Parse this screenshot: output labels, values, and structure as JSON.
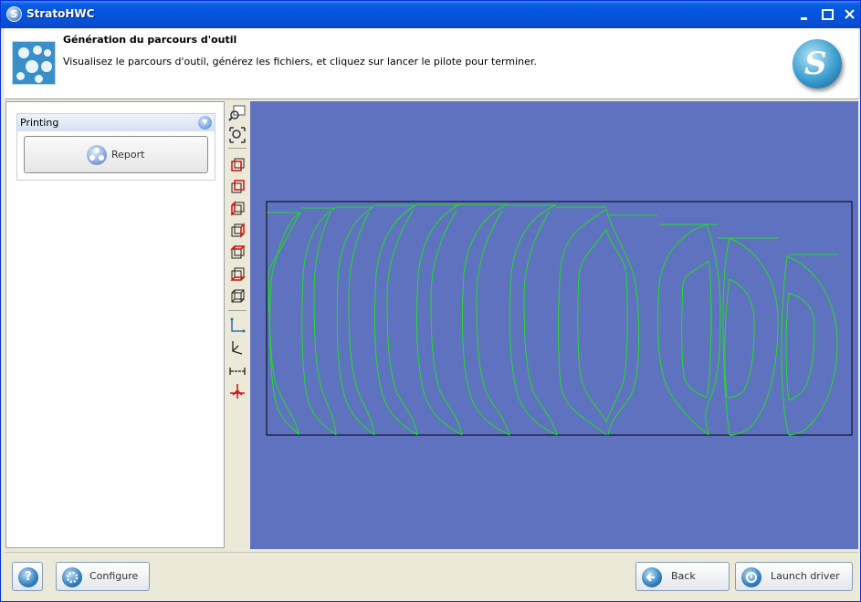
{
  "window": {
    "title": "StratoHWC",
    "app_icon_letter": "S"
  },
  "header": {
    "title": "Génération du parcours d'outil",
    "description": "Visualisez le parcours d'outil, générez les fichiers, et cliquez sur lancer le pilote pour terminer.",
    "logo_letter": "S"
  },
  "left_panel": {
    "section_label": "Printing",
    "report_label": "Report"
  },
  "toolbar": {
    "tools": [
      "zoom-in-icon",
      "zoom-fit-icon",
      "view-front-icon",
      "view-back-icon",
      "view-left-icon",
      "view-right-icon",
      "view-top-icon",
      "view-bottom-icon",
      "view-iso-icon",
      "axes-xy-icon",
      "axes-xyz-icon",
      "measure-icon",
      "origin-icon"
    ]
  },
  "colors": {
    "viewport_bg": "#5f72bf",
    "toolpath": "#1ee01e",
    "titlebar": "#0355e0"
  },
  "footer": {
    "help_label": "?",
    "configure_label": "Configure",
    "back_label": "Back",
    "launch_label": "Launch driver"
  }
}
